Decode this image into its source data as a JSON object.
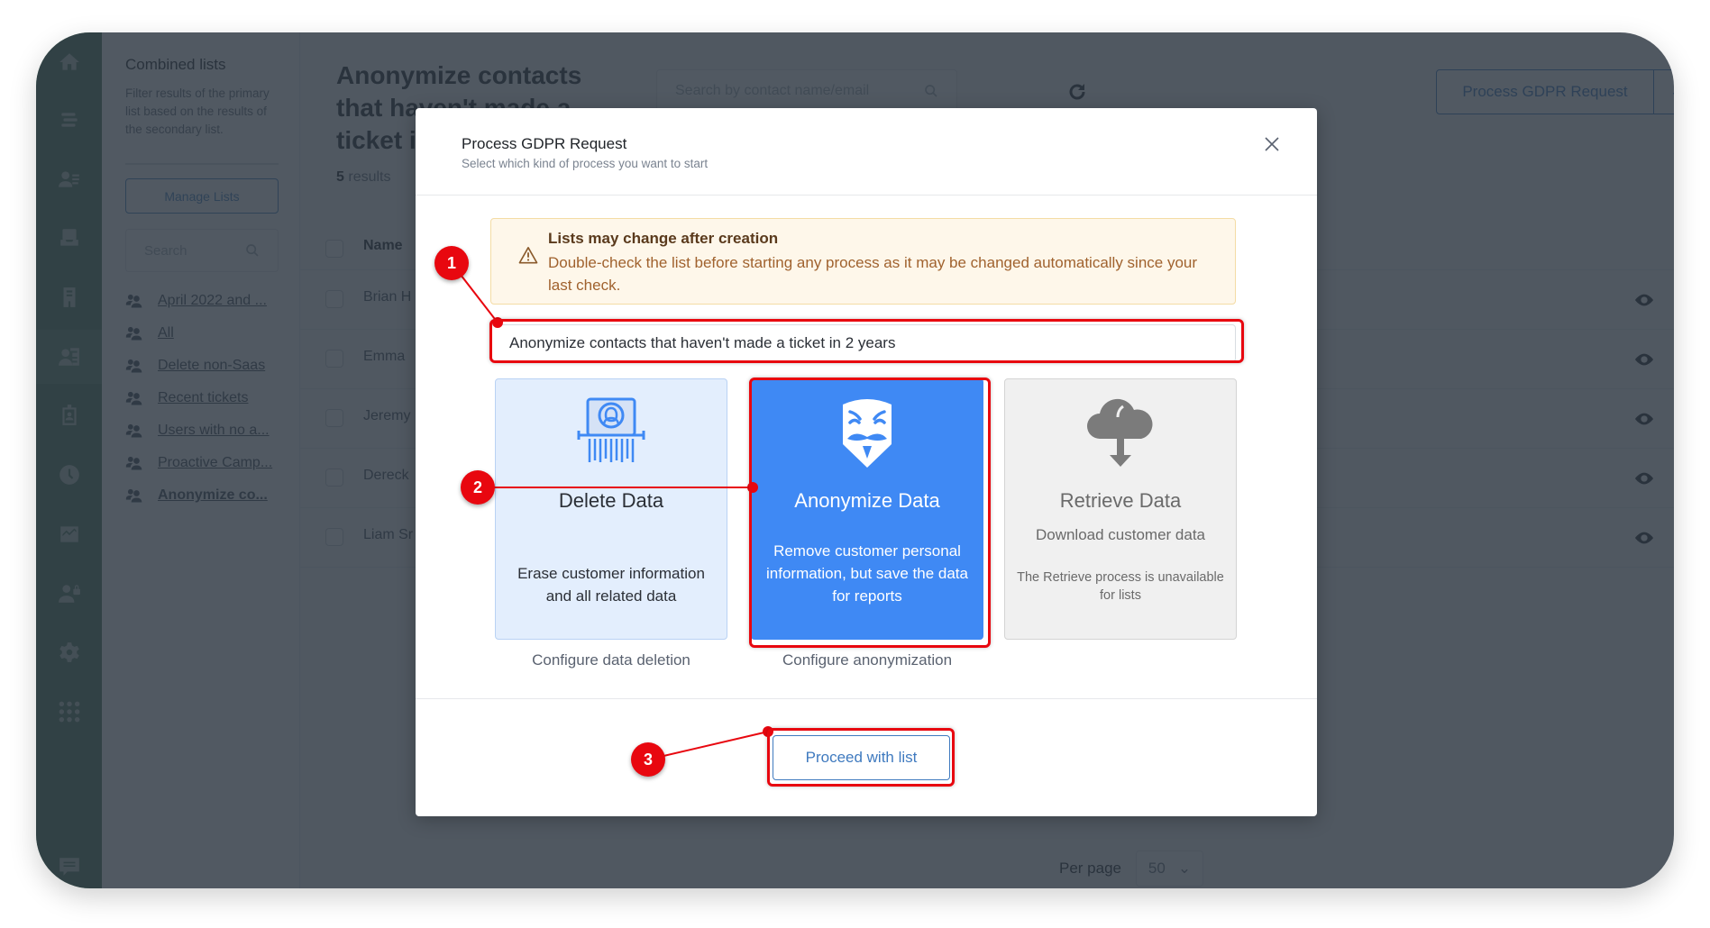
{
  "nav": {
    "items": [
      {
        "name": "home",
        "icon": "home-icon"
      },
      {
        "name": "tickets",
        "icon": "list-icon"
      },
      {
        "name": "contacts",
        "icon": "contact-list-icon"
      },
      {
        "name": "inbox",
        "icon": "inbox-icon"
      },
      {
        "name": "knowledge-base",
        "icon": "building-icon"
      },
      {
        "name": "customer-lists",
        "icon": "contact-card-icon",
        "active": true
      },
      {
        "name": "badge",
        "icon": "id-badge-icon"
      },
      {
        "name": "history",
        "icon": "clock-icon"
      },
      {
        "name": "reports",
        "icon": "chart-icon"
      },
      {
        "name": "user-security",
        "icon": "user-lock-icon"
      },
      {
        "name": "settings",
        "icon": "gear-icon"
      },
      {
        "name": "apps",
        "icon": "grid-icon"
      },
      {
        "name": "chat",
        "icon": "chat-icon"
      }
    ]
  },
  "lists_panel": {
    "title": "Combined lists",
    "description": "Filter results of the primary list based on the results of the secondary list.",
    "manage_label": "Manage Lists",
    "search_placeholder": "Search",
    "items": [
      {
        "label": "April 2022 and ..."
      },
      {
        "label": "All"
      },
      {
        "label": "Delete non-Saas"
      },
      {
        "label": "Recent tickets"
      },
      {
        "label": "Users with no a..."
      },
      {
        "label": "Proactive Camp..."
      },
      {
        "label": "Anonymize co...",
        "active": true
      }
    ]
  },
  "page": {
    "title": "Anonymize contacts that haven't made a ticket in 2 years",
    "result_count": "5",
    "result_label": "results",
    "search_placeholder": "Search by contact name/email",
    "gdpr_button_label": "Process GDPR Request",
    "table": {
      "header_name": "Name",
      "rows": [
        {
          "name": "Brian H"
        },
        {
          "name": "Emma"
        },
        {
          "name": "Jeremy"
        },
        {
          "name": "Dereck"
        },
        {
          "name": "Liam Sr"
        }
      ]
    },
    "per_page_label": "Per page",
    "per_page_value": "50"
  },
  "modal": {
    "title": "Process GDPR Request",
    "subtitle": "Select which kind of process you want to start",
    "warning": {
      "title": "Lists may change after creation",
      "text": "Double-check the list before starting any process as it may be changed automatically since your last check."
    },
    "list_name": "Anonymize contacts that haven't made a ticket in 2 years",
    "options": [
      {
        "id": "delete",
        "title": "Delete Data",
        "description": "Erase customer information and all related data",
        "link": "Configure data deletion",
        "icon": "data-shredder-icon"
      },
      {
        "id": "anonymize",
        "title": "Anonymize Data",
        "description": "Remove customer personal information, but save the data for reports",
        "link": "Configure anonymization",
        "icon": "anonymous-mask-icon",
        "selected": true
      },
      {
        "id": "retrieve",
        "title": "Retrieve Data",
        "description": "Download customer data",
        "note": "The Retrieve process is unavailable for lists",
        "icon": "cloud-download-icon",
        "disabled": true
      }
    ],
    "proceed_label": "Proceed with list"
  },
  "annotations": [
    {
      "number": "1",
      "target": "list-name-field"
    },
    {
      "number": "2",
      "target": "anonymize-data-card"
    },
    {
      "number": "3",
      "target": "proceed-button"
    }
  ],
  "colors": {
    "accent": "#3f89f4",
    "annotation_red": "#e8070f",
    "nav_green": "#4e7a5d",
    "warning_bg": "#fef7ea"
  }
}
